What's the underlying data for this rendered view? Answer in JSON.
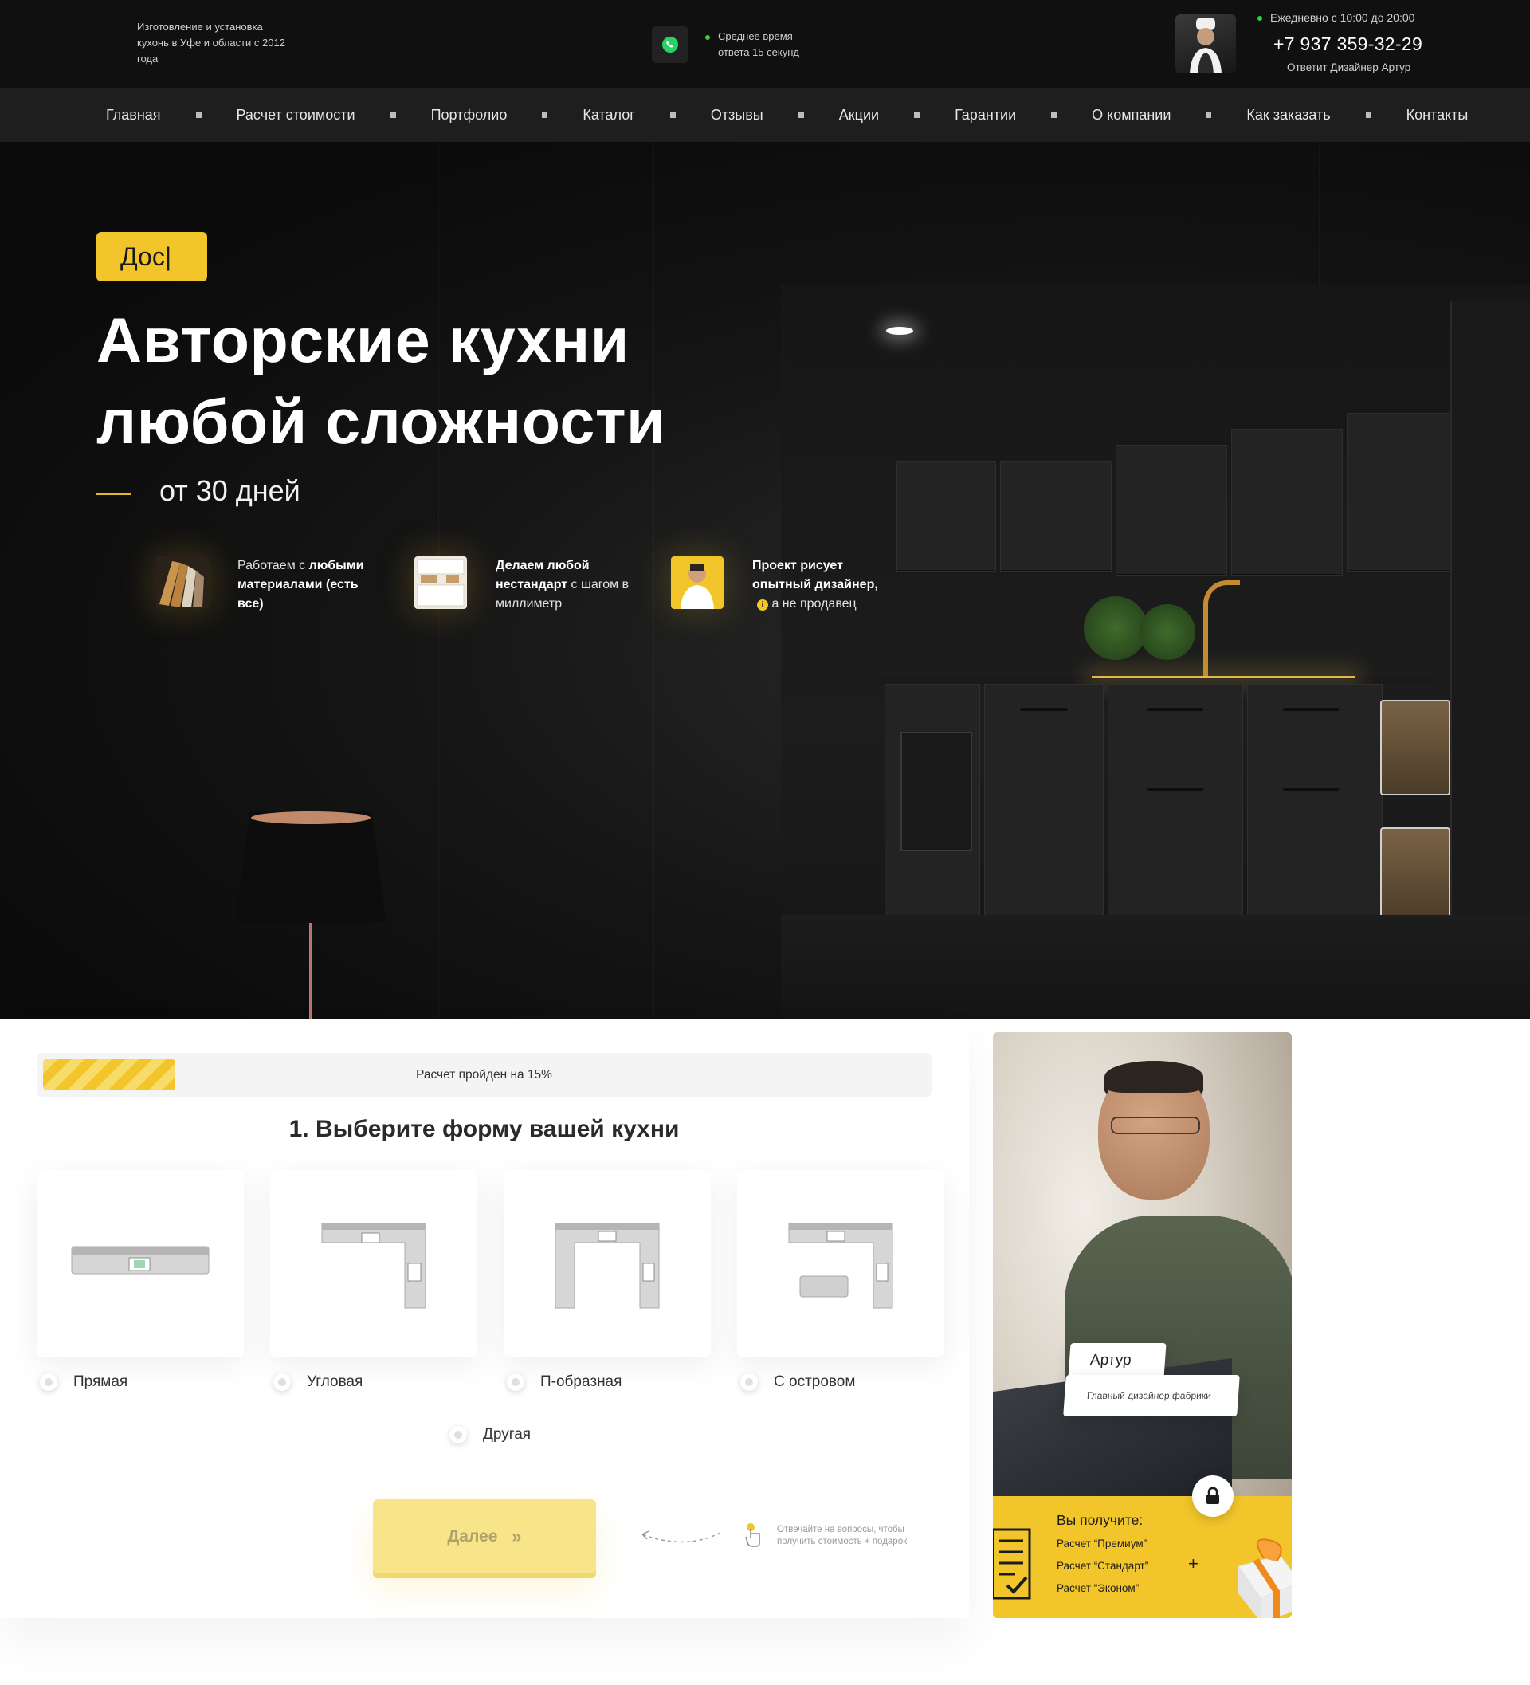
{
  "header": {
    "about": "Изготовление и установка кухонь в Уфе и области с 2012 года",
    "response_time": "Среднее время ответа 15 секунд",
    "hours": "Ежедневно с 10:00 до 20:00",
    "phone": "+7 937 359-32-29",
    "answer_by": "Ответит Дизайнер Артур"
  },
  "nav": {
    "items": [
      "Главная",
      "Расчет стоимости",
      "Портфолио",
      "Каталог",
      "Отзывы",
      "Акции",
      "Гарантии",
      "О компании",
      "Как заказать",
      "Контакты"
    ]
  },
  "hero": {
    "badge": "Дос|",
    "title_line1": "Авторские кухни",
    "title_line2": "любой сложности",
    "subtitle": "от 30 дней",
    "features": [
      {
        "pre": "Работаем с ",
        "bold": "любыми материалами",
        "post": " (есть все)"
      },
      {
        "bold": "Делаем любой нестандарт",
        "post": " с шагом в миллиметр"
      },
      {
        "bold": "Проект рисует опытный дизайнер,",
        "post": " а не продавец",
        "info_icon": "i"
      }
    ]
  },
  "calculator": {
    "progress_text": "Расчет пройден на 15%",
    "progress_value": 0.15,
    "title": "1. Выберите форму вашей кухни",
    "options": [
      "Прямая",
      "Угловая",
      "П-образная",
      "С островом",
      "Другая"
    ],
    "next_label": "Далее",
    "next_arrow": "»",
    "hint": "Отвечайте на вопросы, чтобы получить стоимость + подарок"
  },
  "designer": {
    "name": "Артур",
    "role": "Главный дизайнер фабрики",
    "get_title": "Вы получите:",
    "get_items": [
      "Расчет “Премиум”",
      "Расчет “Стандарт”",
      "Расчет “Эконом”"
    ],
    "plus": "+"
  },
  "colors": {
    "accent": "#f2c62b",
    "dark": "#101010",
    "nav_bg": "#1e1e1e",
    "whatsapp": "#25d366"
  },
  "icons": [
    "whatsapp-icon",
    "lock-icon",
    "pointer-hand-icon",
    "gift-icon",
    "document-check-icon",
    "info-icon"
  ]
}
